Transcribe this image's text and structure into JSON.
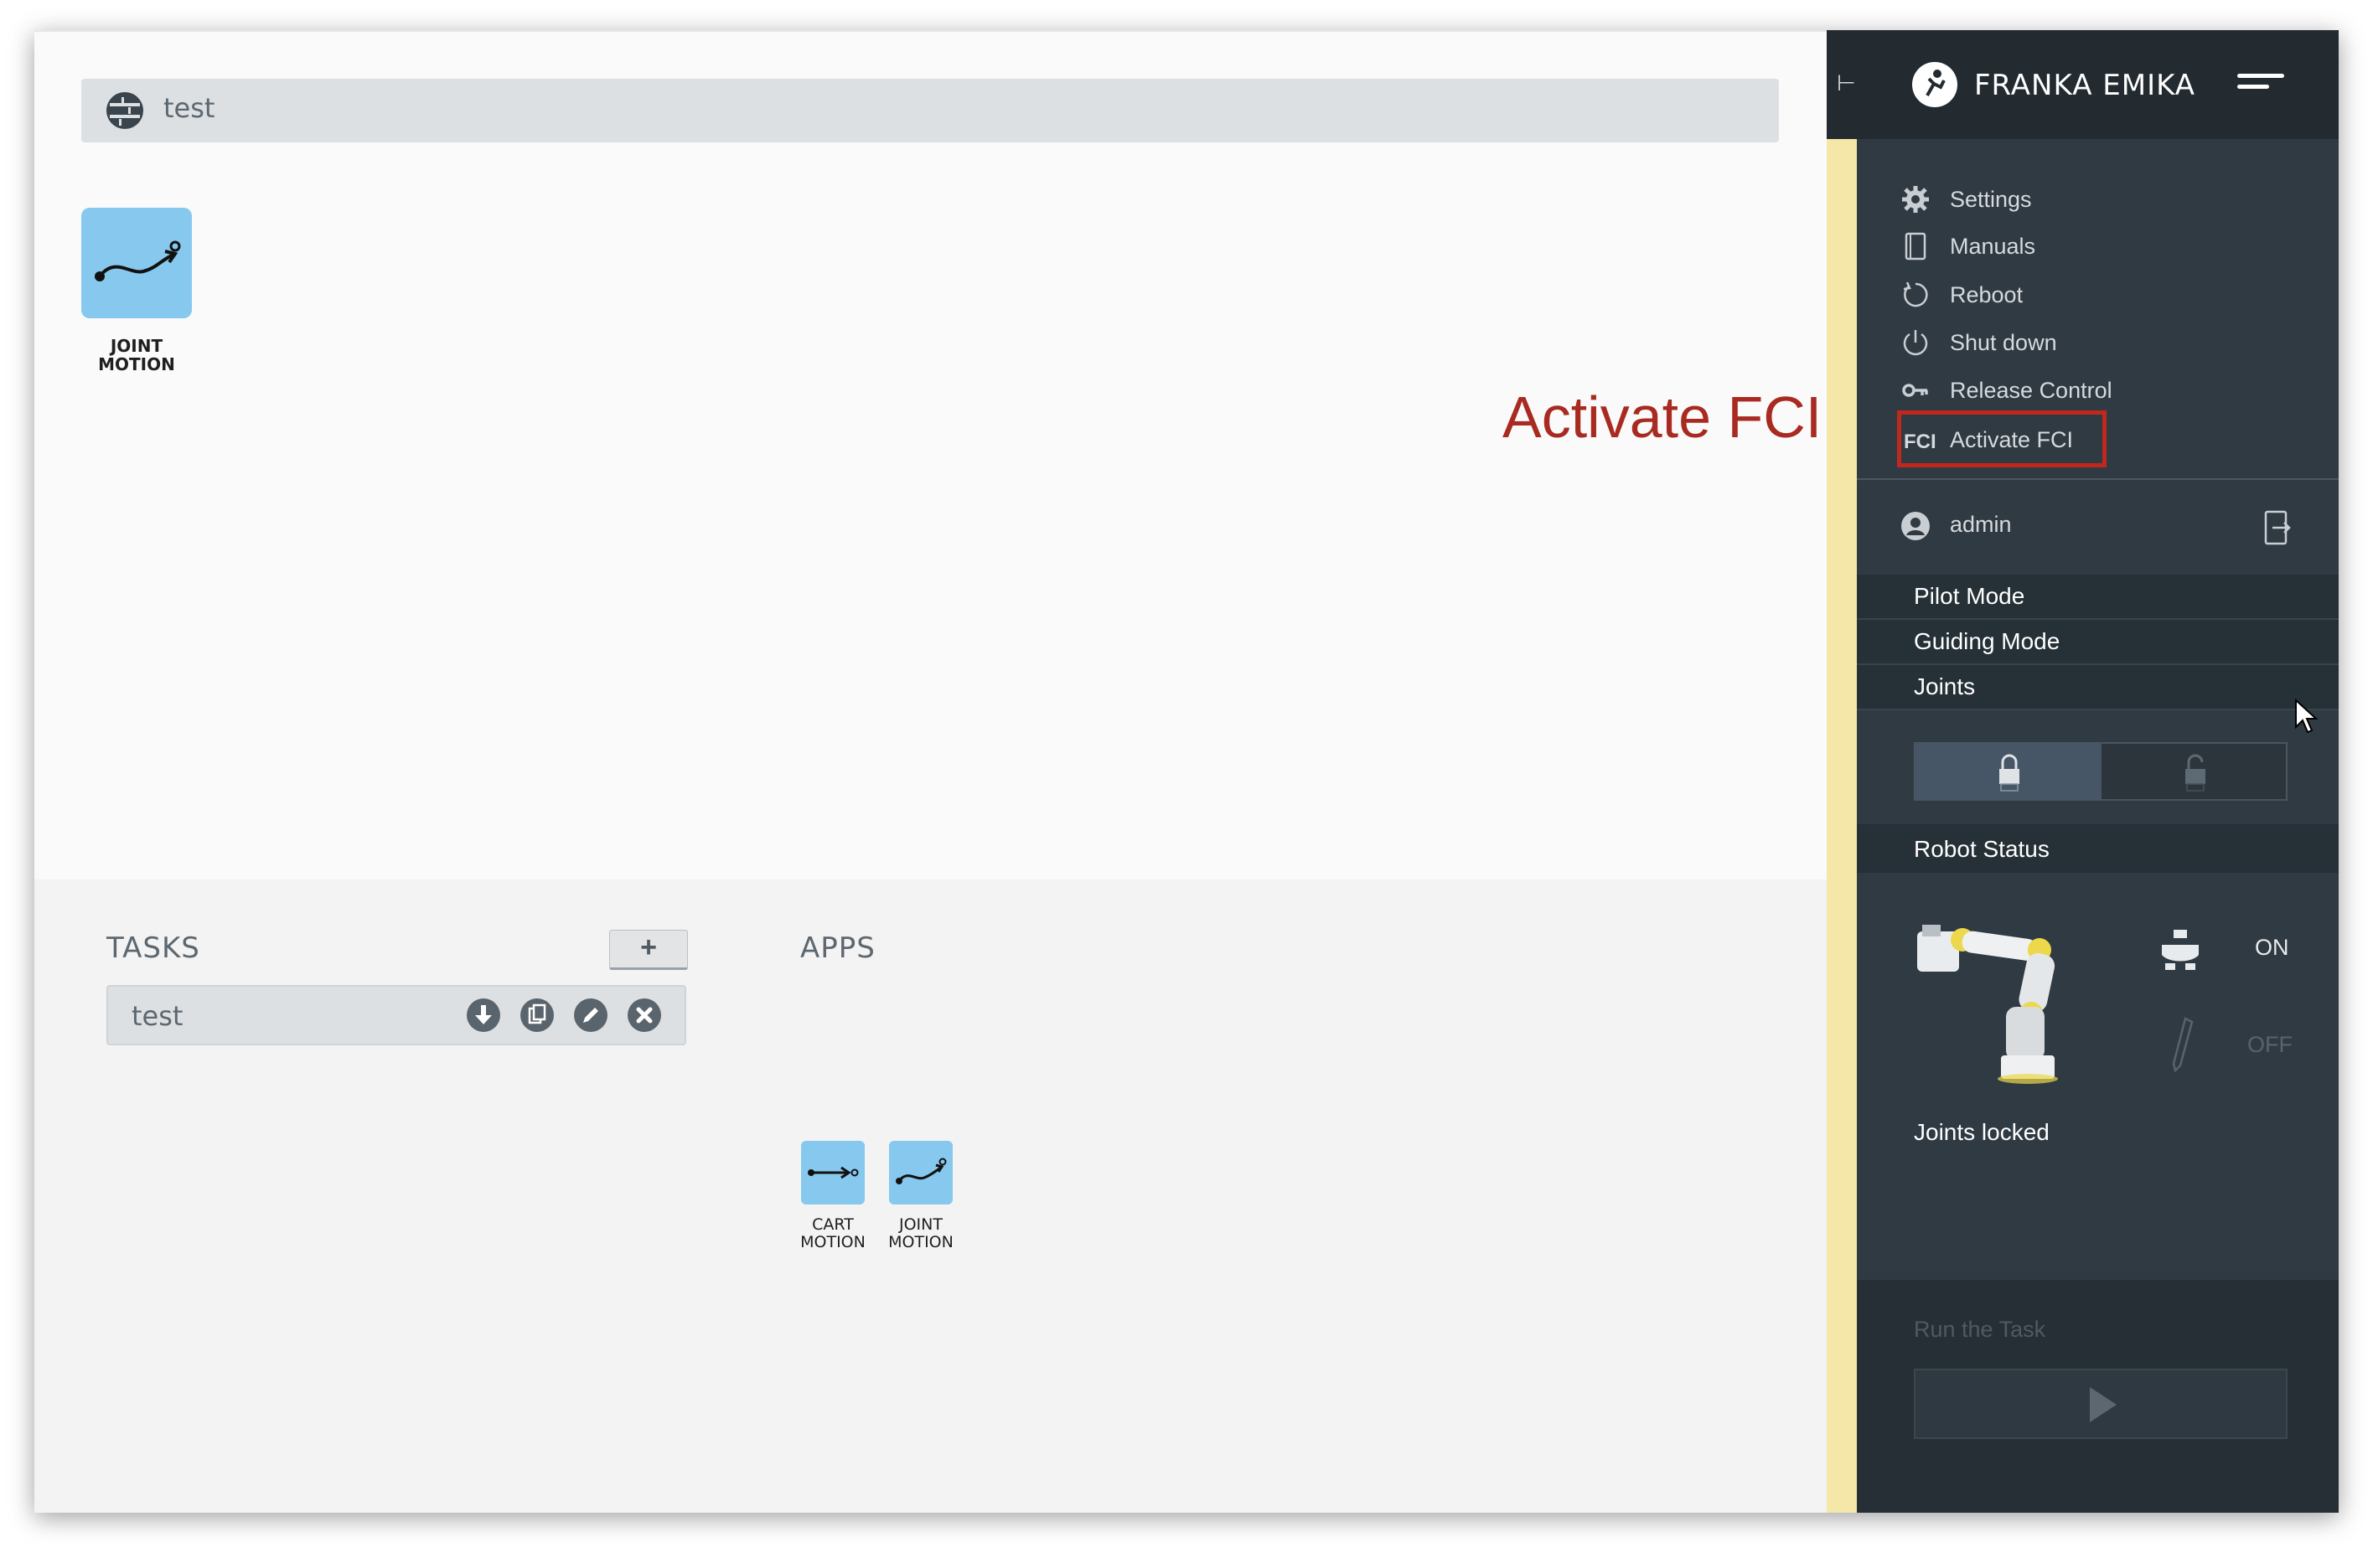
{
  "topbar": {
    "title": "test"
  },
  "canvas": {
    "app": {
      "label_line1": "JOINT",
      "label_line2": "MOTION"
    }
  },
  "tasks": {
    "heading": "TASKS",
    "add_label": "+",
    "items": [
      {
        "name": "test"
      }
    ]
  },
  "apps": {
    "heading": "APPS",
    "items": [
      {
        "label_line1": "CART",
        "label_line2": "MOTION",
        "icon": "cart-motion-icon"
      },
      {
        "label_line1": "JOINT",
        "label_line2": "MOTION",
        "icon": "joint-motion-icon"
      }
    ]
  },
  "annotation": {
    "text": "Activate FCI",
    "color": "#a82a21"
  },
  "sidebar": {
    "brand": "FRANKA EMIKA",
    "menu": [
      {
        "label": "Settings",
        "icon": "gear-icon"
      },
      {
        "label": "Manuals",
        "icon": "book-icon"
      },
      {
        "label": "Reboot",
        "icon": "reboot-icon"
      },
      {
        "label": "Shut down",
        "icon": "power-icon"
      },
      {
        "label": "Release Control",
        "icon": "key-icon"
      }
    ],
    "fci": {
      "tag": "FCI",
      "label": "Activate FCI"
    },
    "user": {
      "name": "admin"
    },
    "sections": {
      "pilot_mode": "Pilot Mode",
      "guiding_mode": "Guiding Mode",
      "joints": "Joints"
    },
    "robot_status": {
      "heading": "Robot Status",
      "on_label": "ON",
      "off_label": "OFF",
      "joints_state": "Joints locked"
    },
    "run": {
      "label": "Run the Task"
    }
  },
  "colors": {
    "app_tile": "#86c8ee",
    "sidebar_bg": "#303a42",
    "header_bg": "#232a30",
    "accent_strip": "#f5e7a8",
    "highlight_box": "#c0281e"
  }
}
